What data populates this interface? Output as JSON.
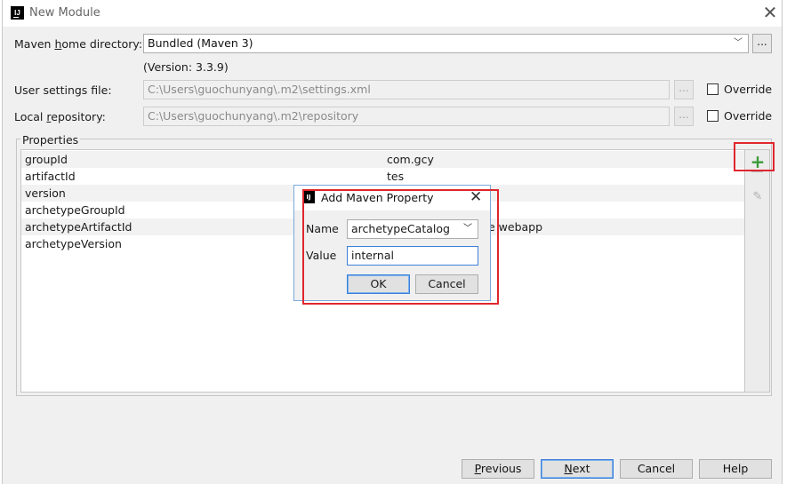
{
  "window": {
    "title": "New Module",
    "icon": "intellij-icon"
  },
  "form": {
    "maven_home": {
      "label_pre": "Maven ",
      "label_accel": "h",
      "label_post": "ome directory:",
      "value": "Bundled (Maven 3)",
      "version": "(Version: 3.3.9)"
    },
    "user_settings": {
      "label": "User settings file:",
      "value": "C:\\Users\\guochunyang\\.m2\\settings.xml",
      "override": "Override"
    },
    "local_repo": {
      "label_pre": "Local ",
      "label_accel": "r",
      "label_post": "epository:",
      "value": "C:\\Users\\guochunyang\\.m2\\repository",
      "override": "Override"
    },
    "browse_label": "..."
  },
  "properties": {
    "title": "Properties",
    "rows": [
      {
        "key": "groupId",
        "value": "com.gcy"
      },
      {
        "key": "artifactId",
        "value": "tes"
      },
      {
        "key": "version",
        "value": ""
      },
      {
        "key": "archetypeGroupId",
        "value": ""
      },
      {
        "key": "archetypeArtifactId",
        "value": "e webapp"
      },
      {
        "key": "archetypeVersion",
        "value": ""
      }
    ]
  },
  "buttons": {
    "previous_pre": "",
    "previous_accel": "P",
    "previous_post": "revious",
    "next_pre": "",
    "next_accel": "N",
    "next_post": "ext",
    "cancel": "Cancel",
    "help": "Help"
  },
  "dialog": {
    "title": "Add Maven Property",
    "name_label": "Name",
    "name_value": "archetypeCatalog",
    "value_label": "Value",
    "value_value": "internal",
    "ok": "OK",
    "cancel": "Cancel"
  },
  "colors": {
    "highlight": "#e0262d",
    "add": "#3a9a3a",
    "focus": "#3c7fd8"
  }
}
